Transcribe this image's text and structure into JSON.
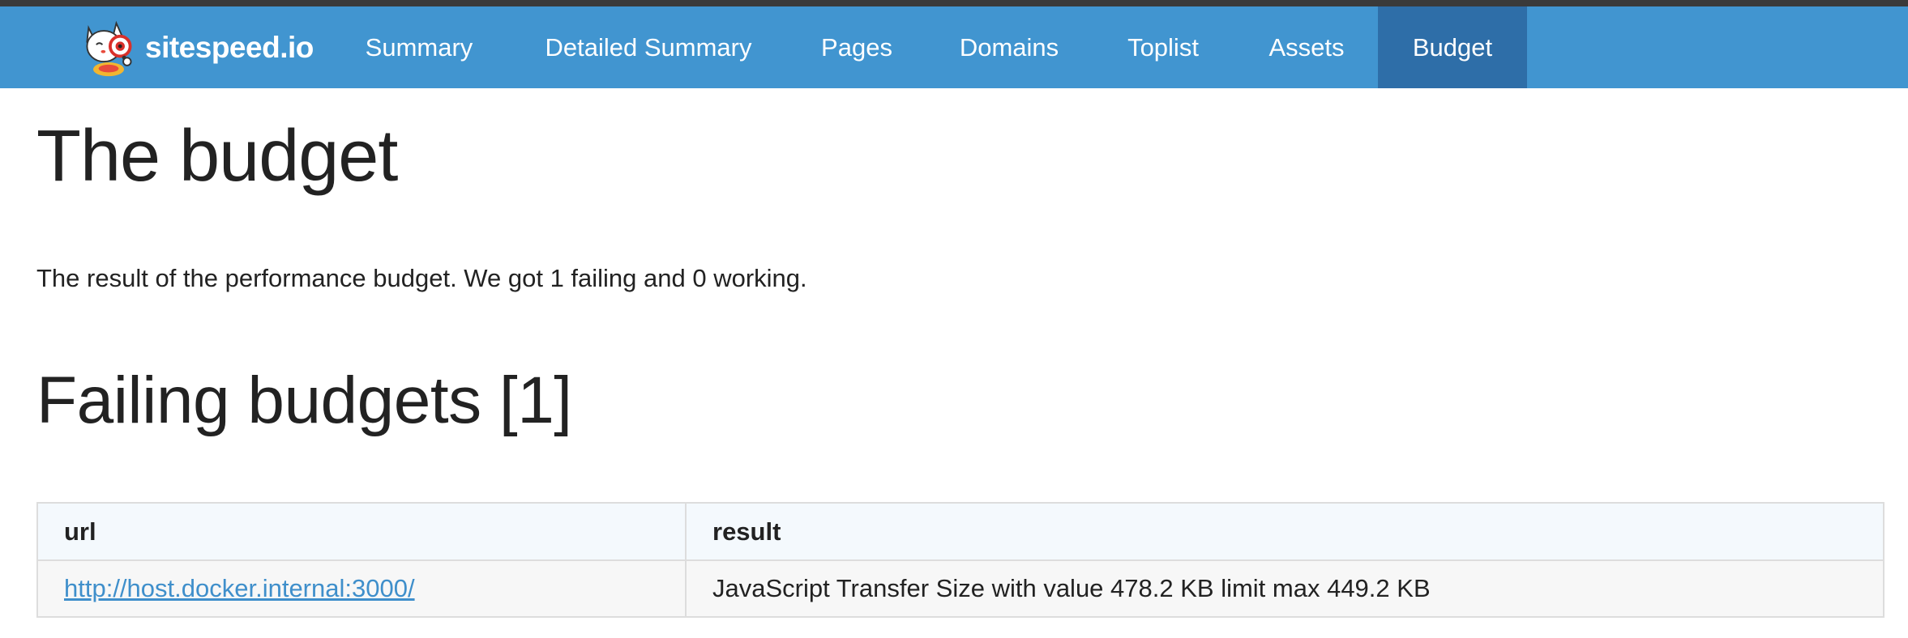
{
  "navbar": {
    "brand": "sitespeed.io",
    "logo_icon": "sitespeed-mascot-icon",
    "items": [
      {
        "label": "Summary",
        "active": false
      },
      {
        "label": "Detailed Summary",
        "active": false
      },
      {
        "label": "Pages",
        "active": false
      },
      {
        "label": "Domains",
        "active": false
      },
      {
        "label": "Toplist",
        "active": false
      },
      {
        "label": "Assets",
        "active": false
      },
      {
        "label": "Budget",
        "active": true
      }
    ],
    "colors": {
      "bar": "#4195d0",
      "active": "#2e6ea8",
      "text": "#ffffff"
    }
  },
  "main": {
    "title": "The budget",
    "intro": "The result of the performance budget. We got 1 failing and 0 working.",
    "failing_title": "Failing budgets [1]",
    "table": {
      "headers": [
        "url",
        "result"
      ],
      "rows": [
        {
          "url": "http://host.docker.internal:3000/",
          "result": "JavaScript Transfer Size with value 478.2 KB limit max 449.2 KB"
        }
      ]
    },
    "link_color": "#3f8fcb"
  }
}
